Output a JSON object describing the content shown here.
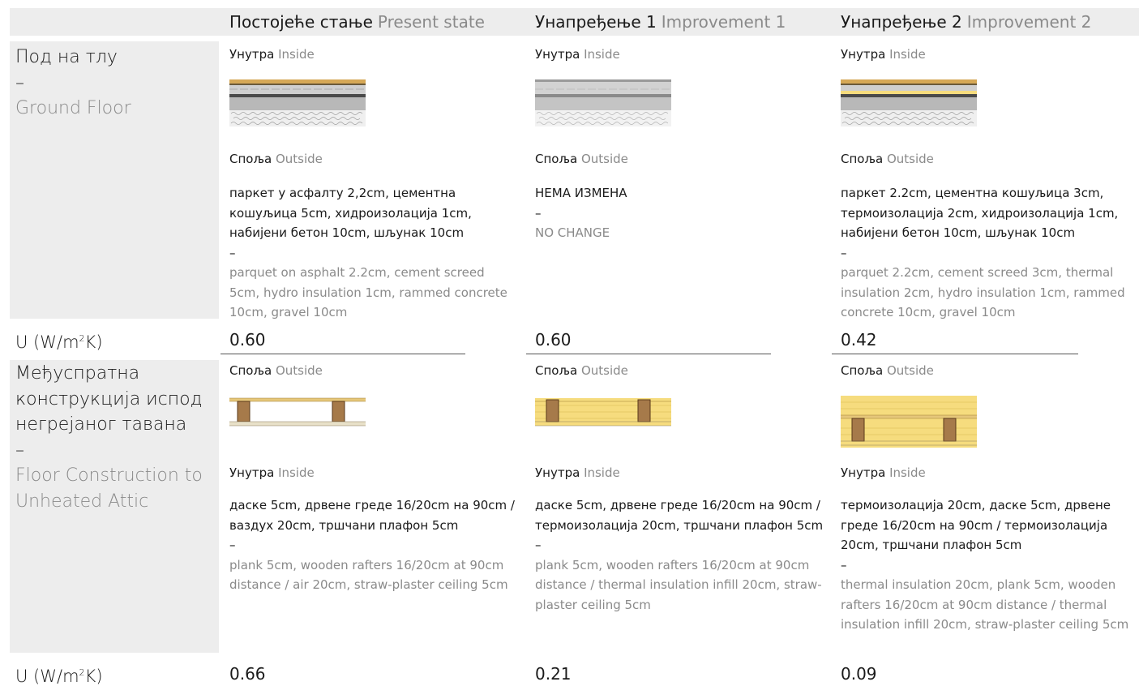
{
  "header": {
    "present": {
      "sr": "Постојеће стање",
      "en": "Present state"
    },
    "imp1": {
      "sr": "Унапређење 1",
      "en": "Improvement 1"
    },
    "imp2": {
      "sr": "Унапређење 2",
      "en": "Improvement 2"
    }
  },
  "labels": {
    "inside_sr": "Унутра",
    "inside_en": "Inside",
    "outside_sr": "Споља",
    "outside_en": "Outside",
    "dash": "–",
    "u_label": "U (W/m",
    "u_sup": "2",
    "u_suffix": "K)"
  },
  "rows": {
    "ground": {
      "title_sr": "Под на тлу",
      "title_en": "Ground Floor",
      "present": {
        "sr": "паркет у асфалту 2,2cm, цементна кошуљица 5cm, хидроизолација 1cm, набијени бетон 10cm, шљунак 10cm",
        "en": "parquet on asphalt 2.2cm, cement screed 5cm, hydro insulation 1cm, rammed concrete 10cm, gravel 10cm",
        "u": "0.60"
      },
      "imp1": {
        "sr": "НЕМА ИЗМЕНА",
        "en": "NO CHANGE",
        "u": "0.60"
      },
      "imp2": {
        "sr": "паркет 2.2cm, цементна кошуљица 3cm, термоизолација 2cm, хидроизолација 1cm, набијени бетон 10cm, шљунак 10cm",
        "en": "parquet 2.2cm, cement screed 3cm, thermal insulation 2cm, hydro insulation 1cm, rammed concrete 10cm, gravel 10cm",
        "u": "0.42"
      }
    },
    "attic": {
      "title_sr": "Међуспратна конструкција испод негрејаног тавана",
      "title_en": "Floor Construction to Unheated Attic",
      "present": {
        "sr": "даске 5cm, дрвене греде 16/20cm на 90cm / ваздух 20cm, тршчани плафон 5cm",
        "en": "plank 5cm, wooden rafters 16/20cm at 90cm distance / air 20cm, straw-plaster ceiling 5cm",
        "u": "0.66"
      },
      "imp1": {
        "sr": "даске 5cm, дрвене греде 16/20cm на 90cm / термоизолација 20cm, тршчани плафон 5cm",
        "en": "plank 5cm, wooden rafters 16/20cm at 90cm distance / thermal insulation infill 20cm, straw-plaster ceiling 5cm",
        "u": "0.21"
      },
      "imp2": {
        "sr": "термоизолација 20cm, даске 5cm, дрвене греде 16/20cm на 90cm / термоизолација 20cm, тршчани плафон 5cm",
        "en": "thermal insulation 20cm, plank 5cm, wooden rafters 16/20cm at 90cm distance / thermal insulation infill 20cm, straw-plaster ceiling 5cm",
        "u": "0.09"
      }
    }
  },
  "colors": {
    "panel": "#ededed",
    "english_text": "#8a8a8a",
    "insulation": "#f6dc7e",
    "timber": "#a67a4a",
    "concrete": "#bdbdbd",
    "parquet": "#d6a856"
  }
}
